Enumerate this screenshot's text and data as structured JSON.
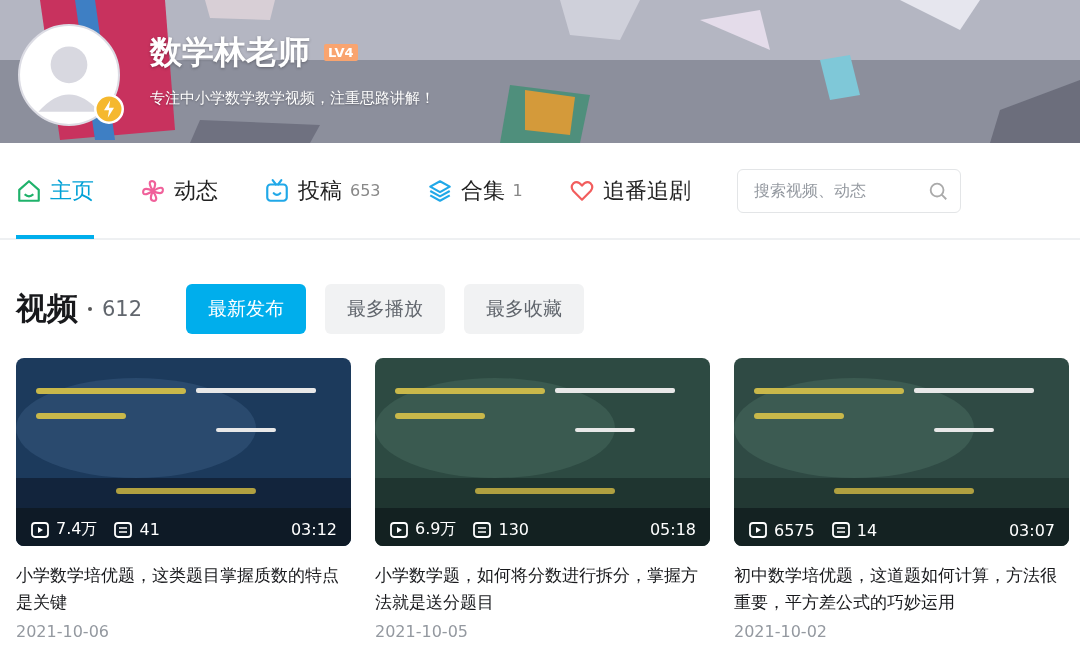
{
  "profile": {
    "name": "数学林老师",
    "level_badge": "LV4",
    "bio": "专注中小学数学教学视频，注重思路讲解！"
  },
  "tabs": [
    {
      "kind": "home",
      "label": "主页",
      "selected": true
    },
    {
      "kind": "dynamic",
      "label": "动态",
      "selected": false
    },
    {
      "kind": "upload",
      "label": "投稿",
      "count": "653",
      "selected": false
    },
    {
      "kind": "collection",
      "label": "合集",
      "count": "1",
      "selected": false
    },
    {
      "kind": "follow",
      "label": "追番追剧",
      "selected": false
    }
  ],
  "search": {
    "placeholder": "搜索视频、动态"
  },
  "section": {
    "title": "视频",
    "count": "612"
  },
  "sort_buttons": [
    {
      "label": "最新发布",
      "selected": true
    },
    {
      "label": "最多播放",
      "selected": false
    },
    {
      "label": "最多收藏",
      "selected": false
    }
  ],
  "videos": [
    {
      "kind": "picture",
      "views": "7.4万",
      "comments": "41",
      "duration": "03:12",
      "title": "小学数学培优题，这类题目掌握质数的特点是关键",
      "date": "2021-10-06"
    },
    {
      "kind": "picture",
      "views": "6.9万",
      "comments": "130",
      "duration": "05:18",
      "title": "小学数学题，如何将分数进行拆分，掌握方法就是送分题目",
      "date": "2021-10-05"
    },
    {
      "kind": "picture",
      "views": "6575",
      "comments": "14",
      "duration": "03:07",
      "title": "初中数学培优题，这道题如何计算，方法很重要，平方差公式的巧妙运用",
      "date": "2021-10-02"
    }
  ]
}
